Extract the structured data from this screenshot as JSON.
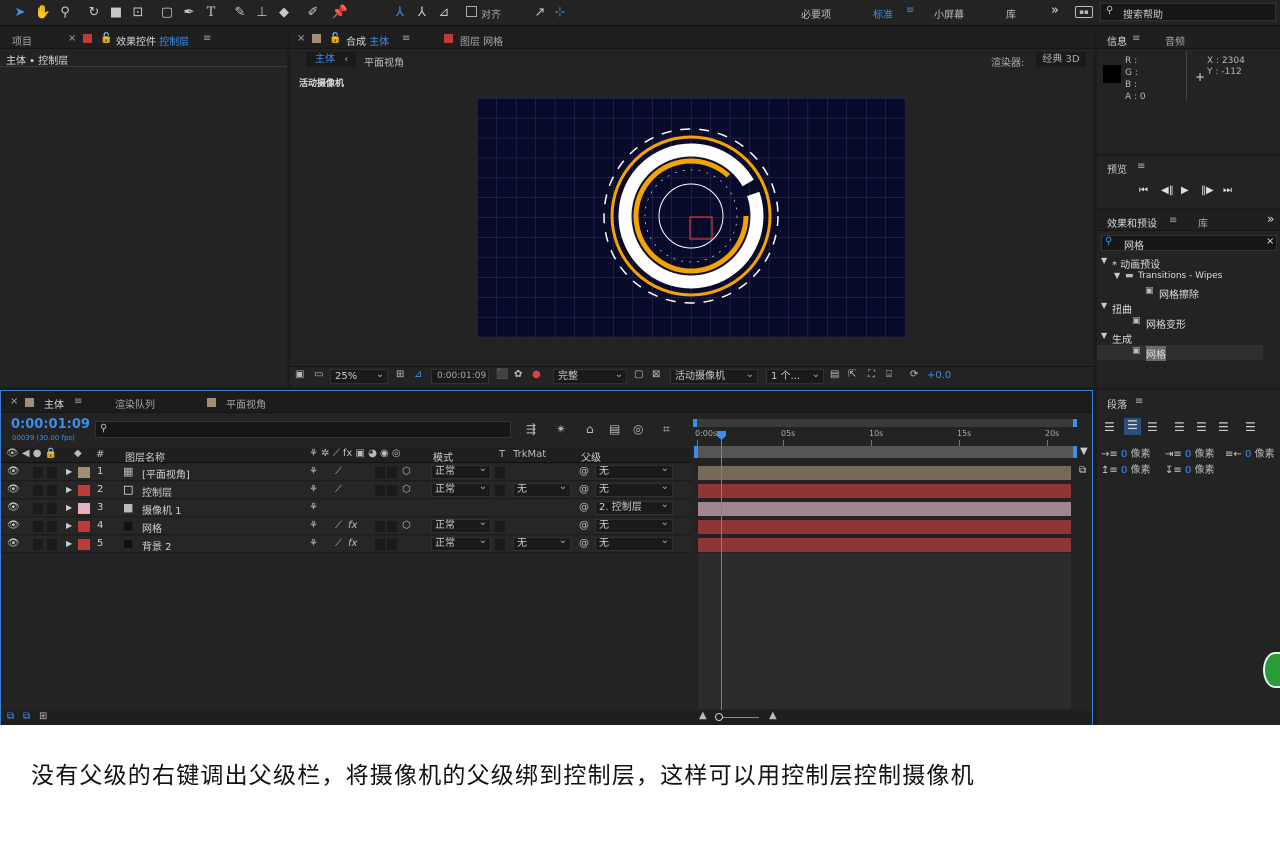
{
  "toolbar": {
    "snap_label": "对齐",
    "workspaces": [
      "必要项",
      "标准",
      "小屏幕",
      "库"
    ],
    "search_placeholder": "搜索帮助"
  },
  "project_panel": {
    "tab_project": "项目",
    "tab_effects": "效果控件",
    "effects_target": "控制层",
    "breadcrumb": "主体 • 控制层"
  },
  "comp_panel": {
    "tab_comp_prefix": "合成",
    "tab_comp_name": "主体",
    "tab_layer_prefix": "图层",
    "tab_layer_name": "网格",
    "subtabs": [
      "主体",
      "平面视角"
    ],
    "renderer_label": "渲染器:",
    "renderer_value": "经典 3D",
    "view_label": "活动摄像机",
    "zoom": "25%",
    "timecode": "0:00:01:09",
    "resolution": "完整",
    "camera": "活动摄像机",
    "views": "1 个...",
    "exposure": "+0.0"
  },
  "info_panel": {
    "tab_info": "信息",
    "tab_audio": "音频",
    "r": "R :",
    "g": "G :",
    "b": "B :",
    "a": "A : 0",
    "x": "X : 2304",
    "y": "Y : -112"
  },
  "preview_panel": {
    "title": "预览"
  },
  "effects_presets": {
    "tab": "效果和预设",
    "tab_lib": "库",
    "search_value": "网格",
    "tree": [
      {
        "label": "* 动画预设",
        "indent": 0,
        "arrow": "▼"
      },
      {
        "label": "Transitions - Wipes",
        "indent": 1,
        "arrow": "▼"
      },
      {
        "label": "网格擦除",
        "indent": 2,
        "arrow": ""
      },
      {
        "label": "扭曲",
        "indent": 0,
        "arrow": "▼"
      },
      {
        "label": "网格变形",
        "indent": 1,
        "arrow": ""
      },
      {
        "label": "生成",
        "indent": 0,
        "arrow": "▼"
      },
      {
        "label": "网格",
        "indent": 1,
        "arrow": ""
      }
    ]
  },
  "paragraph_panel": {
    "title": "段落",
    "indent_unit": "像素",
    "indent_values": [
      "0",
      "0",
      "0",
      "0",
      "0"
    ]
  },
  "timeline": {
    "tab_main": "主体",
    "tab_render": "渲染队列",
    "tab_flat": "平面视角",
    "timecode": "0:00:01:09",
    "frame_info": "00039 (30.00 fps)",
    "search_placeholder": "",
    "headers": {
      "num": "#",
      "name": "图层名称",
      "mode": "模式",
      "t": "T",
      "trkmat": "TrkMat",
      "parent": "父级"
    },
    "ruler": [
      "0:00s",
      "05s",
      "10s",
      "15s",
      "20s"
    ],
    "layers": [
      {
        "num": "1",
        "name": "[平面视角]",
        "color": "#a08f75",
        "mode": "正常",
        "trkmat": "",
        "parent": "无",
        "bar": "#77695a"
      },
      {
        "num": "2",
        "name": "控制层",
        "color": "#c03a3a",
        "mode": "正常",
        "trkmat": "无",
        "parent": "无",
        "bar": "#8e3535"
      },
      {
        "num": "3",
        "name": "摄像机 1",
        "color": "#e6b2bd",
        "mode": "",
        "trkmat": "",
        "parent": "2. 控制层",
        "bar": "#a38590"
      },
      {
        "num": "4",
        "name": "网格",
        "color": "#c03a3a",
        "mode": "正常",
        "trkmat": "",
        "parent": "无",
        "bar": "#8e3535"
      },
      {
        "num": "5",
        "name": "背景 2",
        "color": "#c03a3a",
        "mode": "正常",
        "trkmat": "无",
        "parent": "无",
        "bar": "#8e3535"
      }
    ]
  },
  "caption": "没有父级的右键调出父级栏，将摄像机的父级绑到控制层，这样可以用控制层控制摄像机",
  "colors": {
    "accent": "#3d8ee8",
    "ring_orange": "#f5a300",
    "ring_white": "#ffffff",
    "grid_bg": "#080a2a"
  }
}
